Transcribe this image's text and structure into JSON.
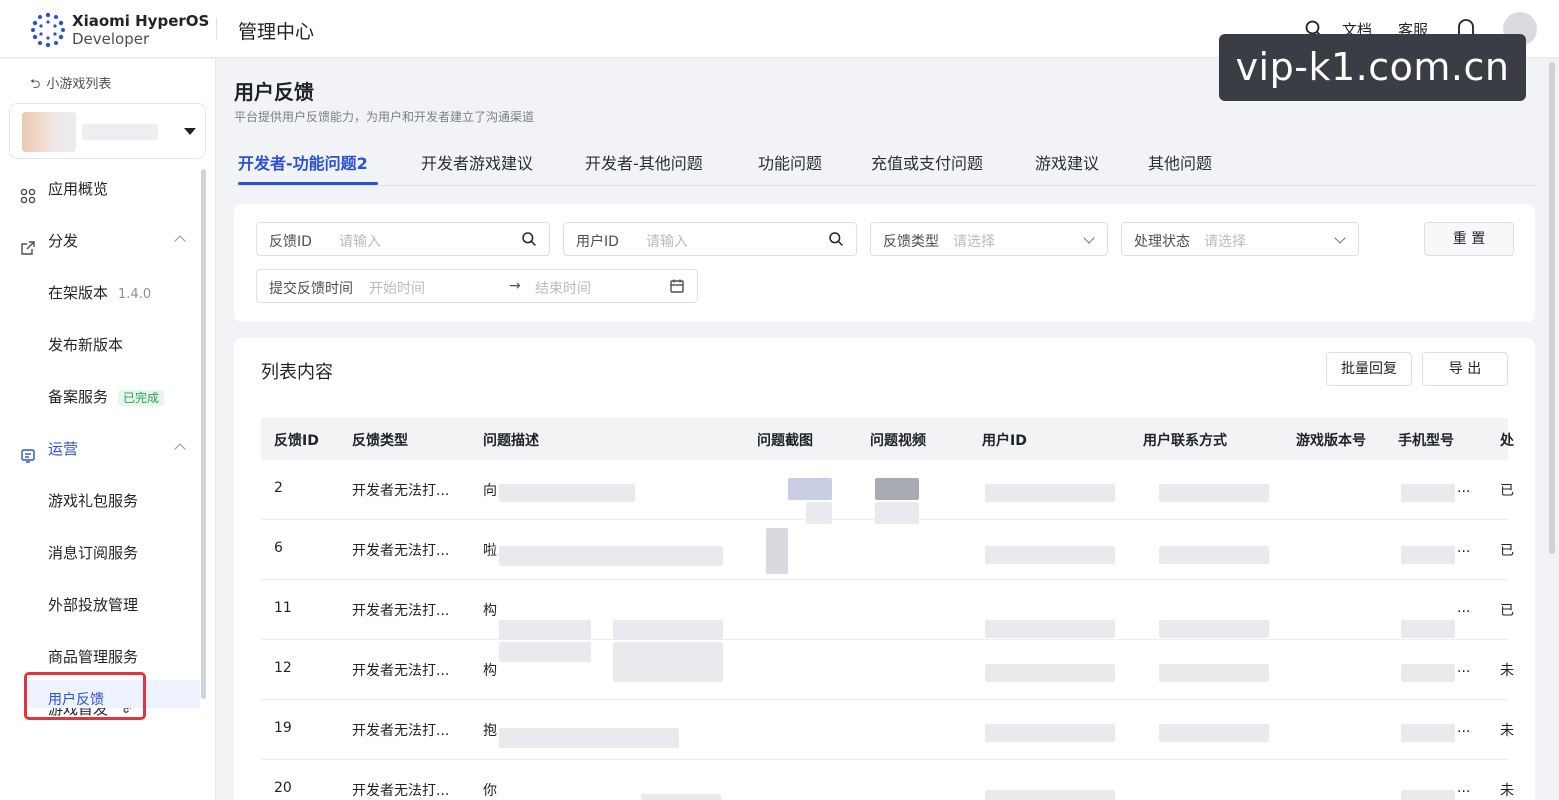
{
  "header": {
    "brand_line1": "Xiaomi HyperOS",
    "brand_line2": "Developer",
    "title": "管理中心",
    "docs": "文档",
    "service": "客服"
  },
  "watermark": "vip-k1.com.cn",
  "sidebar": {
    "back": "小游戏列表",
    "items": [
      {
        "label": "应用概览"
      },
      {
        "label": "分发"
      },
      {
        "label": "在架版本",
        "badge": "1.4.0"
      },
      {
        "label": "发布新版本"
      },
      {
        "label": "备案服务",
        "badge": "已完成"
      },
      {
        "label": "运营"
      },
      {
        "label": "游戏礼包服务"
      },
      {
        "label": "消息订阅服务"
      },
      {
        "label": "外部投放管理"
      },
      {
        "label": "商品管理服务"
      },
      {
        "label": "游戏首发"
      },
      {
        "label": "用户反馈"
      }
    ]
  },
  "page": {
    "title": "用户反馈",
    "subtitle": "平台提供用户反馈能力，为用户和开发者建立了沟通渠道"
  },
  "tabs": [
    "开发者-功能问题2",
    "开发者游戏建议",
    "开发者-其他问题",
    "功能问题",
    "充值或支付问题",
    "游戏建议",
    "其他问题"
  ],
  "filters": {
    "feedback_id_label": "反馈ID",
    "feedback_id_placeholder": "请输入",
    "user_id_label": "用户ID",
    "user_id_placeholder": "请输入",
    "type_label": "反馈类型",
    "type_placeholder": "请选择",
    "status_label": "处理状态",
    "status_placeholder": "请选择",
    "reset": "重 置",
    "time_label": "提交反馈时间",
    "time_start": "开始时间",
    "time_arrow": "→",
    "time_end": "结束时间"
  },
  "list": {
    "title": "列表内容",
    "batch_reply": "批量回复",
    "export": "导 出",
    "columns": [
      "反馈ID",
      "反馈类型",
      "问题描述",
      "问题截图",
      "问题视频",
      "用户ID",
      "用户联系方式",
      "游戏版本号",
      "手机型号",
      "处"
    ],
    "rows": [
      {
        "id": "2",
        "type": "开发者无法打...",
        "desc": "向",
        "model": "...",
        "status": "已"
      },
      {
        "id": "6",
        "type": "开发者无法打...",
        "desc": "啦",
        "model": "...",
        "status": "已"
      },
      {
        "id": "11",
        "type": "开发者无法打...",
        "desc": "构",
        "model": "...",
        "status": "已"
      },
      {
        "id": "12",
        "type": "开发者无法打...",
        "desc": "构",
        "model": "...",
        "status": "未"
      },
      {
        "id": "19",
        "type": "开发者无法打...",
        "desc": "抱",
        "model": "...",
        "status": "未"
      },
      {
        "id": "20",
        "type": "开发者无法打...",
        "desc": "你",
        "model": "...",
        "status": "未"
      }
    ]
  },
  "colors": {
    "accent": "#2b4fd8",
    "highlight": "#e0353f",
    "success": "#27a15a"
  }
}
